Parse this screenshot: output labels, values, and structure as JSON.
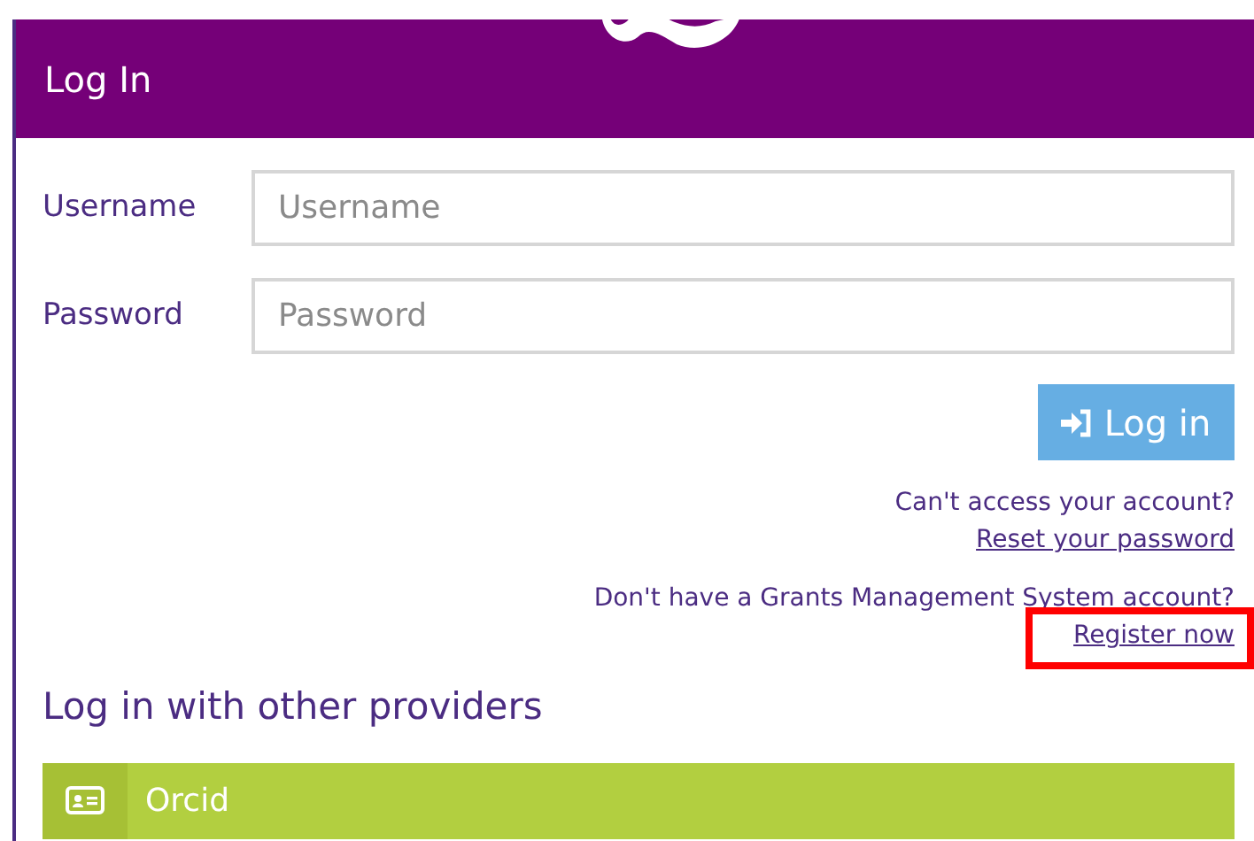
{
  "panel": {
    "title": "Log In"
  },
  "fields": [
    {
      "label": "Username",
      "placeholder": "Username"
    },
    {
      "label": "Password",
      "placeholder": "Password"
    }
  ],
  "login_button": {
    "label": "Log in"
  },
  "help": [
    {
      "prompt": "Can't access your account?",
      "link": "Reset your password",
      "highlighted": false
    },
    {
      "prompt": "Don't have a Grants Management System account?",
      "link": "Register now",
      "highlighted": true
    }
  ],
  "providers": {
    "heading": "Log in with other providers",
    "items": [
      {
        "label": "Orcid"
      }
    ]
  }
}
